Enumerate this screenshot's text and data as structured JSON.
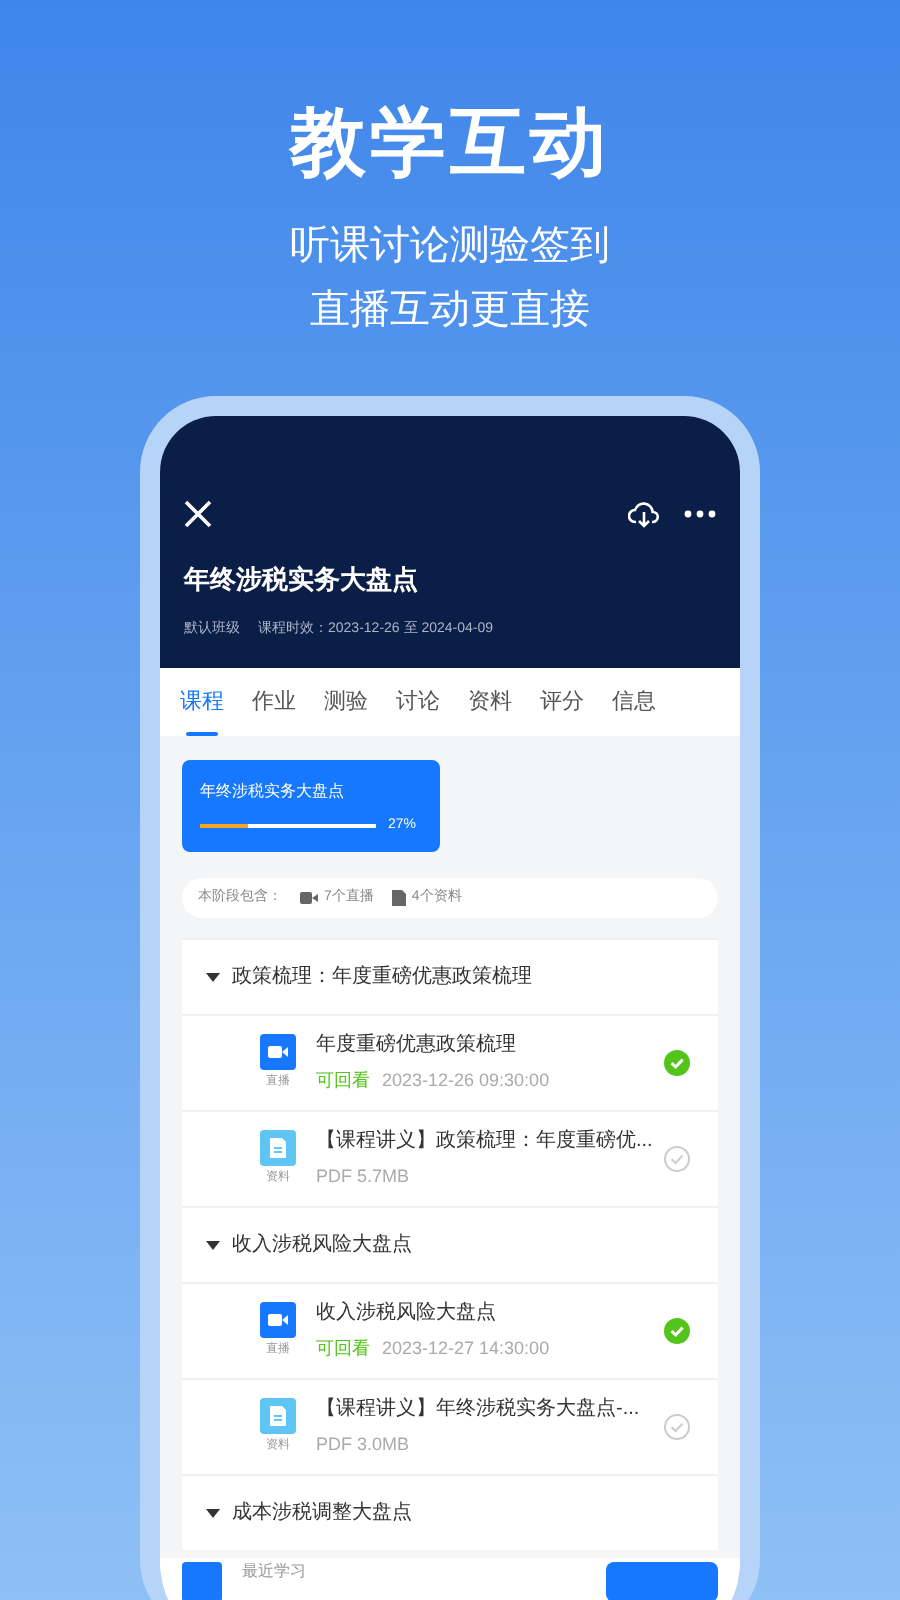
{
  "headline": "教学互动",
  "subtitles": [
    "听课讨论测验签到",
    "直播互动更直接"
  ],
  "course": {
    "title": "年终涉税实务大盘点",
    "class_name": "默认班级",
    "period": "课程时效：2023-12-26 至 2024-04-09"
  },
  "tabs": [
    {
      "label": "课程",
      "selected": true
    },
    {
      "label": "作业",
      "selected": false
    },
    {
      "label": "测验",
      "selected": false
    },
    {
      "label": "讨论",
      "selected": false
    },
    {
      "label": "资料",
      "selected": false
    },
    {
      "label": "评分",
      "selected": false
    },
    {
      "label": "信息",
      "selected": false
    }
  ],
  "stage_card": {
    "title": "年终涉税实务大盘点",
    "level": 0.27,
    "percent": "27%"
  },
  "stage_summary": {
    "label": "本阶段包含：",
    "live_count": "7个直播",
    "doc_count": "4个资料"
  },
  "sections": [
    {
      "title": "政策梳理：年度重磅优惠政策梳理",
      "expanded": true,
      "items": [
        {
          "kind": "live",
          "type_label": "直播",
          "title": "年度重磅优惠政策梳理",
          "status": "可回看",
          "meta": "2023-12-26 09:30:00",
          "completed": true
        },
        {
          "kind": "doc",
          "type_label": "资料",
          "title": "【课程讲义】政策梳理：年度重磅优...",
          "meta": "PDF 5.7MB",
          "completed": false
        }
      ]
    },
    {
      "title": "收入涉税风险大盘点",
      "expanded": true,
      "items": [
        {
          "kind": "live",
          "type_label": "直播",
          "title": "收入涉税风险大盘点",
          "status": "可回看",
          "meta": "2023-12-27 14:30:00",
          "completed": true
        },
        {
          "kind": "doc",
          "type_label": "资料",
          "title": "【课程讲义】年终涉税实务大盘点-...",
          "meta": "PDF 3.0MB",
          "completed": false
        }
      ]
    },
    {
      "title": "成本涉税调整大盘点",
      "expanded": true
    }
  ],
  "bottom_bar": {
    "label": "最近学习"
  }
}
